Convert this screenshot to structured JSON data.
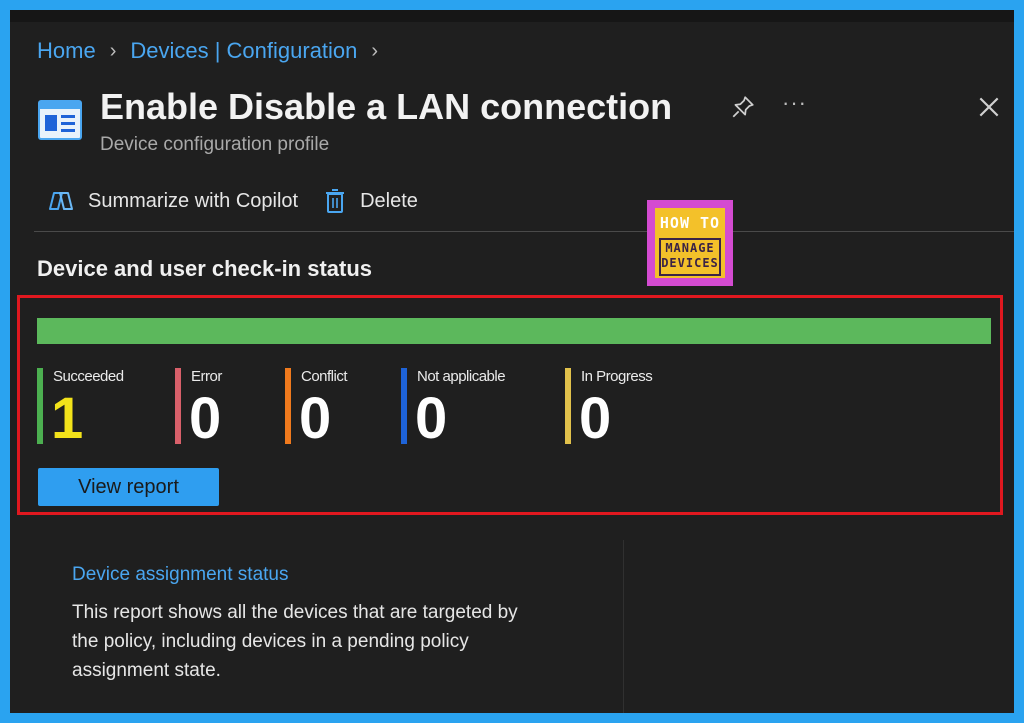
{
  "breadcrumb": {
    "home": "Home",
    "devices": "Devices | Configuration"
  },
  "header": {
    "title": "Enable Disable a LAN connection",
    "subtitle": "Device configuration profile",
    "more": "···"
  },
  "toolbar": {
    "copilot_label": "Summarize with Copilot",
    "delete_label": "Delete"
  },
  "logo": {
    "line1": "HOW TO",
    "line2": "MANAGE",
    "line3": "DEVICES"
  },
  "status": {
    "title": "Device and user check-in status",
    "progress_succeeded_fraction": 1.0,
    "stats": [
      {
        "label": "Succeeded",
        "value": "1",
        "color": "#4caf50",
        "value_color": "#f2e21a"
      },
      {
        "label": "Error",
        "value": "0",
        "color": "#d9606a",
        "value_color": "#ffffff"
      },
      {
        "label": "Conflict",
        "value": "0",
        "color": "#f07a1d",
        "value_color": "#ffffff"
      },
      {
        "label": "Not applicable",
        "value": "0",
        "color": "#1e63d8",
        "value_color": "#ffffff"
      },
      {
        "label": "In Progress",
        "value": "0",
        "color": "#e1c14b",
        "value_color": "#ffffff"
      }
    ],
    "view_report_label": "View report"
  },
  "card": {
    "link": "Device assignment status",
    "text": "This report shows all the devices that are targeted by the policy, including devices in a pending policy assignment state."
  },
  "colors": {
    "accent": "#4aa6f0",
    "highlight_border": "#e0181f",
    "progress": "#5cb85c"
  }
}
